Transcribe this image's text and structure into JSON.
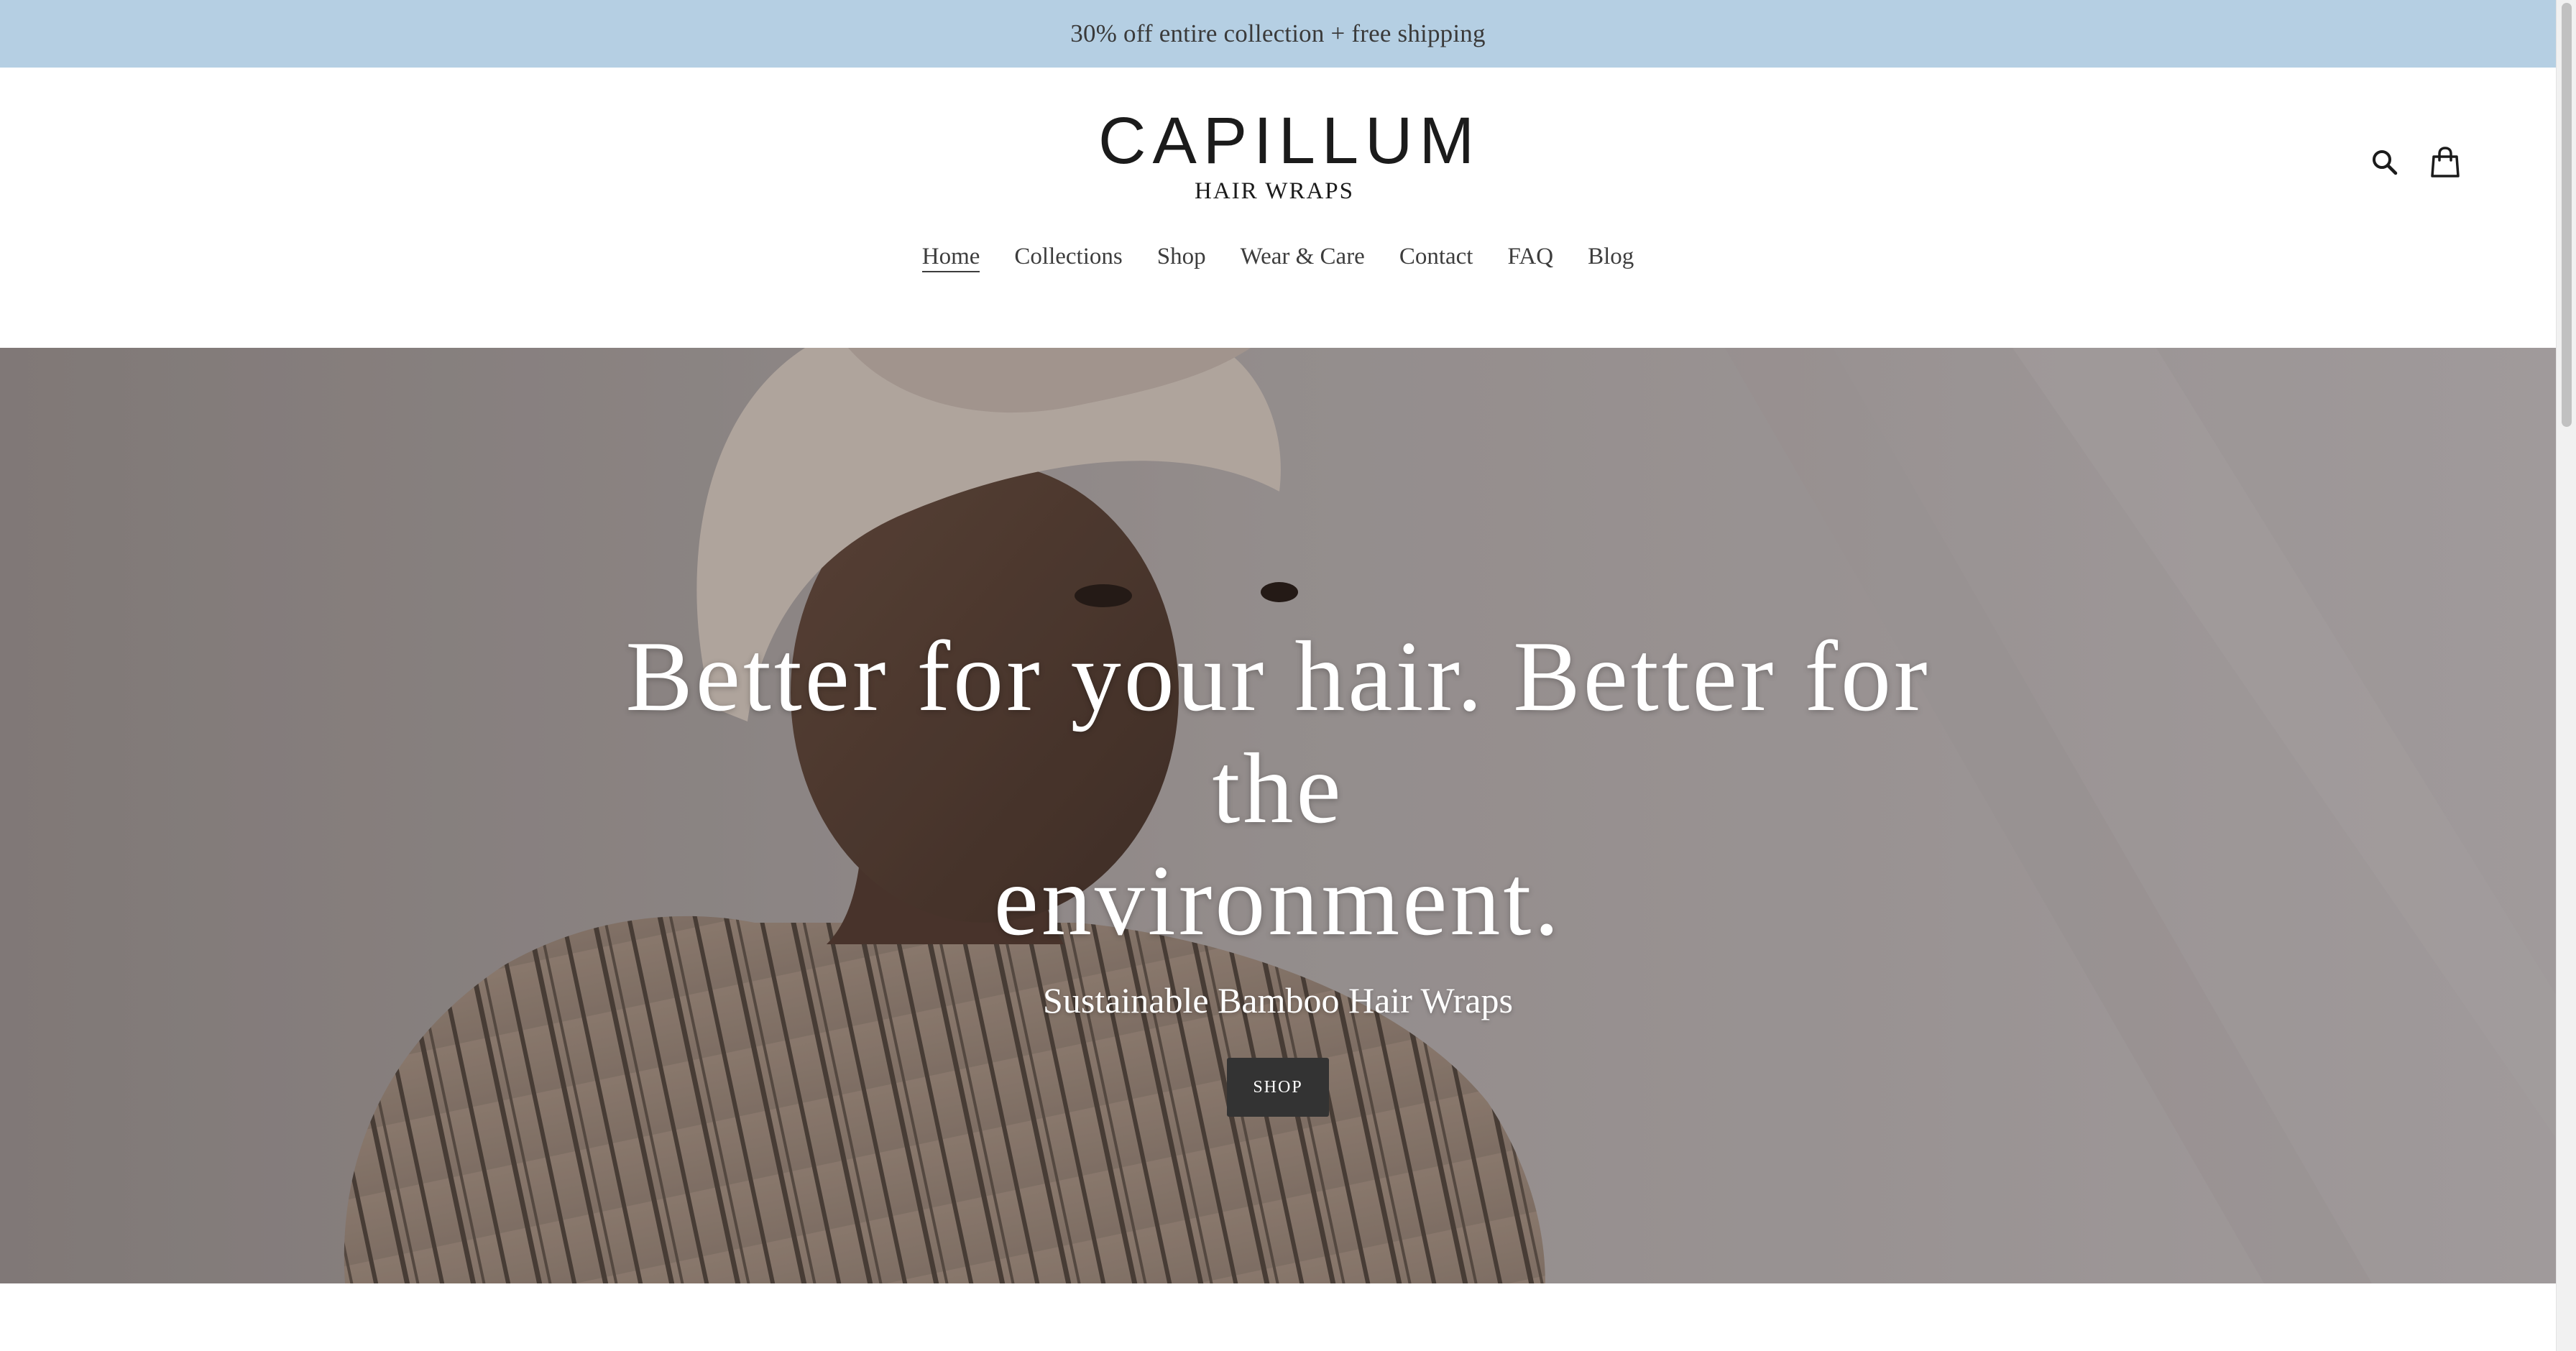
{
  "announcement": {
    "text": "30% off entire collection + free shipping"
  },
  "header": {
    "logo_main": "CAPILLUM",
    "logo_sub": "HAIR WRAPS",
    "icons": [
      "search-icon",
      "cart-icon"
    ]
  },
  "nav": {
    "items": [
      {
        "label": "Home",
        "active": true
      },
      {
        "label": "Collections",
        "active": false
      },
      {
        "label": "Shop",
        "active": false
      },
      {
        "label": "Wear & Care",
        "active": false
      },
      {
        "label": "Contact",
        "active": false
      },
      {
        "label": "FAQ",
        "active": false
      },
      {
        "label": "Blog",
        "active": false
      }
    ]
  },
  "hero": {
    "title_line1": "Better for your hair. Better for the",
    "title_line2": "environment.",
    "subtitle": "Sustainable Bamboo Hair Wraps",
    "button_label": "SHOP"
  },
  "colors": {
    "announcement_bg": "#b5cfe3",
    "button_bg": "#333333",
    "text_dark": "#3d3d3d"
  }
}
